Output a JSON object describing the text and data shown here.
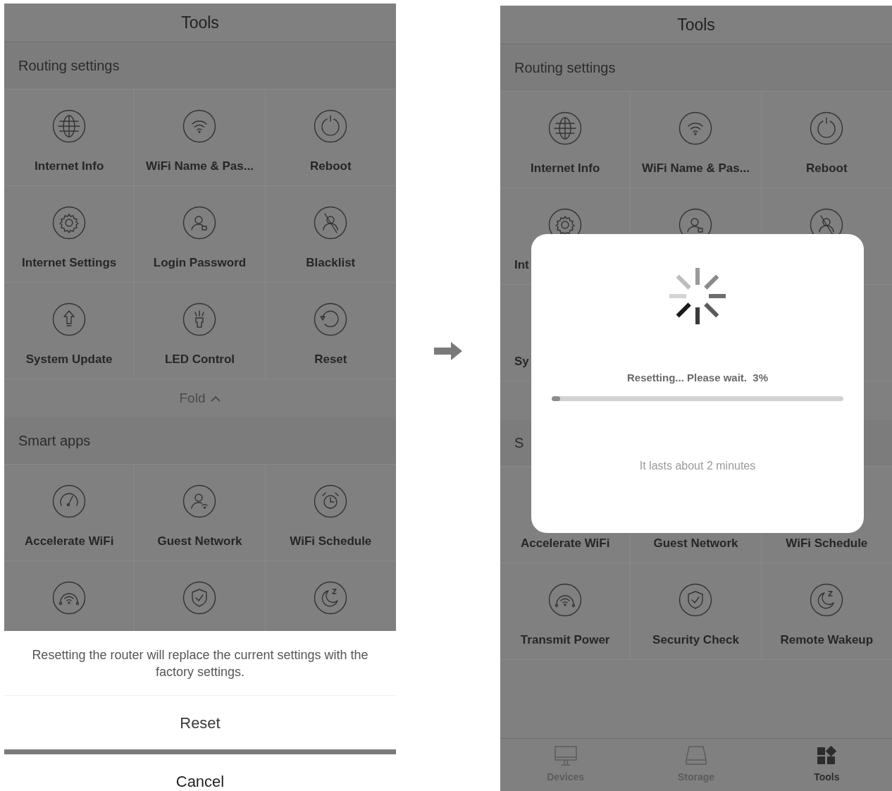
{
  "screens": [
    {
      "title": "Tools",
      "sections": [
        {
          "title": "Routing settings",
          "rows": [
            [
              {
                "kind": "globe",
                "label": "Internet Info"
              },
              {
                "kind": "wifi",
                "label": "WiFi Name & Pas..."
              },
              {
                "kind": "power",
                "label": "Reboot"
              }
            ],
            [
              {
                "kind": "gear",
                "label": "Internet Settings"
              },
              {
                "kind": "person-lock",
                "label": "Login Password"
              },
              {
                "kind": "person-blocked",
                "label": "Blacklist"
              }
            ],
            [
              {
                "kind": "upload",
                "label": "System Update"
              },
              {
                "kind": "lamp",
                "label": "LED Control"
              },
              {
                "kind": "reset",
                "label": "Reset"
              }
            ]
          ],
          "fold": {
            "label": "Fold"
          }
        },
        {
          "title": "Smart apps",
          "rows": [
            [
              {
                "kind": "gauge",
                "label": "Accelerate WiFi"
              },
              {
                "kind": "person-wifi",
                "label": "Guest Network"
              },
              {
                "kind": "alarm",
                "label": "WiFi Schedule"
              }
            ],
            [
              {
                "kind": "wifi-arc"
              },
              {
                "kind": "shield"
              },
              {
                "kind": "moon"
              }
            ]
          ]
        }
      ],
      "action_sheet": {
        "message": "Resetting the router will replace the current settings with the factory settings.",
        "confirm": "Reset",
        "cancel": "Cancel"
      }
    },
    {
      "title": "Tools",
      "sections": [
        {
          "title": "Routing settings",
          "rows": [
            [
              {
                "kind": "globe",
                "label": "Internet Info"
              },
              {
                "kind": "wifi",
                "label": "WiFi Name & Pas..."
              },
              {
                "kind": "power",
                "label": "Reboot"
              }
            ],
            [
              {
                "kind": "gear",
                "label": "Int",
                "cut": true
              },
              {
                "kind": "person-lock"
              },
              {
                "kind": "person-blocked"
              }
            ],
            [
              {
                "label": "Sy",
                "cut": true
              }
            ]
          ]
        },
        {
          "title": "S",
          "rows": [
            [
              {
                "label": "Accelerate WiFi"
              },
              {
                "label": "Guest Network"
              },
              {
                "label": "WiFi Schedule"
              }
            ],
            [
              {
                "kind": "wifi-arc",
                "label": "Transmit Power"
              },
              {
                "kind": "shield",
                "label": "Security Check"
              },
              {
                "kind": "moon",
                "label": "Remote Wakeup"
              }
            ]
          ]
        }
      ],
      "loading_dialog": {
        "message": "Resetting... Please wait.  3%",
        "level": 0.03,
        "note": "It lasts about 2 minutes"
      },
      "tab_bar": [
        {
          "kind": "monitor",
          "label": "Devices",
          "selected": false
        },
        {
          "kind": "drive",
          "label": "Storage",
          "selected": false
        },
        {
          "kind": "tiles",
          "label": "Tools",
          "selected": true
        }
      ]
    }
  ]
}
